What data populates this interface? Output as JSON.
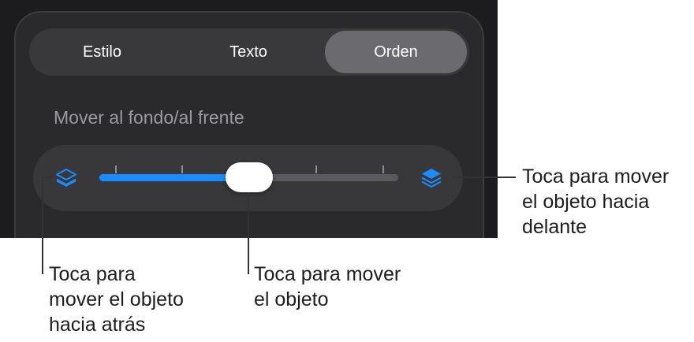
{
  "segmented_control": {
    "tabs": [
      {
        "label": "Estilo",
        "selected": false
      },
      {
        "label": "Texto",
        "selected": false
      },
      {
        "label": "Orden",
        "selected": true
      }
    ]
  },
  "arrange": {
    "section_title": "Mover al fondo/al frente",
    "slider_value_fraction": 0.49,
    "tick_count": 5,
    "accent_color": "#1a8cff",
    "back_icon": "layers-send-backward-icon",
    "front_icon": "layers-bring-forward-icon"
  },
  "callouts": {
    "front": "Toca para mover\nel objeto hacia\ndelante",
    "back": "Toca para\nmover el objeto\nhacia atrás",
    "thumb": "Toca para mover\nel objeto"
  }
}
